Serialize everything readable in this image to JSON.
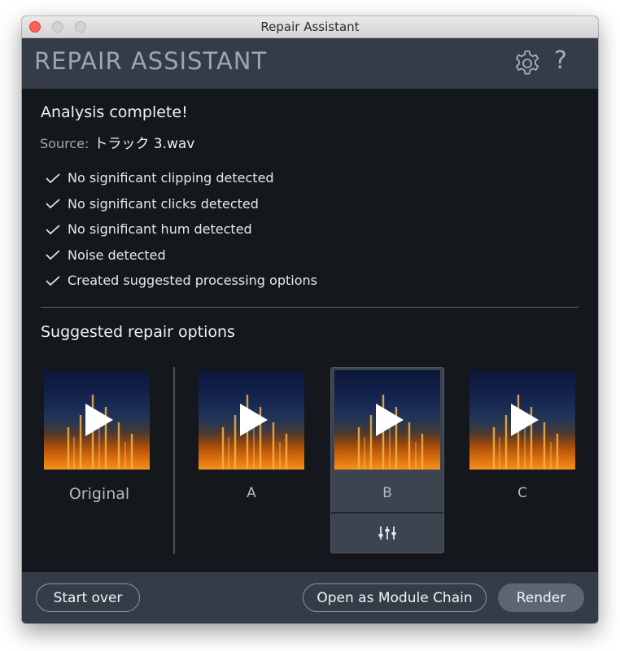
{
  "window": {
    "title": "Repair Assistant"
  },
  "header": {
    "app_title": "REPAIR ASSISTANT",
    "settings_icon": "gear-icon",
    "help_glyph": "?"
  },
  "analysis": {
    "title": "Analysis complete!",
    "source_label": "Source:",
    "source_value": "トラック 3.wav",
    "results": [
      "No significant clipping detected",
      "No significant clicks detected",
      "No significant hum detected",
      "Noise detected",
      "Created suggested processing options"
    ]
  },
  "suggestions": {
    "title": "Suggested repair options",
    "options": [
      {
        "label": "Original"
      },
      {
        "label": "A"
      },
      {
        "label": "B"
      },
      {
        "label": "C"
      }
    ],
    "selected": "B"
  },
  "footer": {
    "start_over": "Start over",
    "open_chain": "Open as Module Chain",
    "render": "Render"
  },
  "colors": {
    "background": "#14181c",
    "header": "#343d47",
    "selected_card": "#3b444f",
    "close_button": "#fc5f57"
  }
}
